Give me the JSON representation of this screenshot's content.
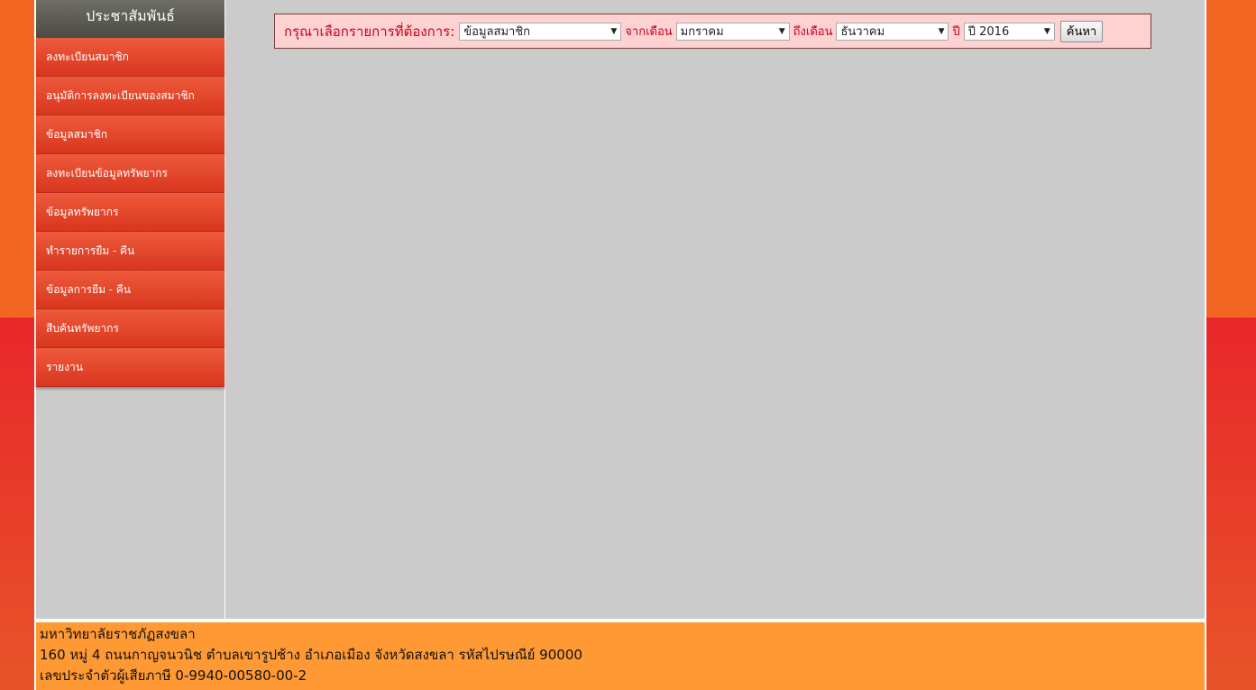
{
  "sidebar": {
    "header": "ประชาสัมพันธ์",
    "items": [
      {
        "label": "ลงทะเบียนสมาชิก"
      },
      {
        "label": "อนุมัติการลงทะเบียนของสมาชิก"
      },
      {
        "label": "ข้อมูลสมาชิก"
      },
      {
        "label": "ลงทะเบียนข้อมูลทรัพยากร"
      },
      {
        "label": "ข้อมูลทรัพยากร"
      },
      {
        "label": "ทำรายการยืม - คืน"
      },
      {
        "label": "ข้อมูลการยืม - คืน"
      },
      {
        "label": "สืบค้นทรัพยากร"
      },
      {
        "label": "รายงาน"
      }
    ]
  },
  "filter": {
    "prompt": "กรุณาเลือกรายการที่ต้องการ:",
    "category_select": "ข้อมูลสมาชิก",
    "from_month_label": "จากเดือน",
    "from_month_select": "มกราคม",
    "to_month_label": "ถึงเดือน",
    "to_month_select": "ธันวาคม",
    "year_label": "ปี",
    "year_select": "ปี 2016",
    "search_button": "ค้นหา"
  },
  "footer": {
    "line1": "มหาวิทยาลัยราชภัฏสงขลา",
    "line2": "160 หมู่ 4 ถนนกาญจนวนิช ตำบลเขารูปช้าง อำเภอเมือง จังหวัดสงขลา รหัสไปรษณีย์ 90000",
    "line3": "เลขประจำตัวผู้เสียภาษี 0-9940-00580-00-2"
  }
}
